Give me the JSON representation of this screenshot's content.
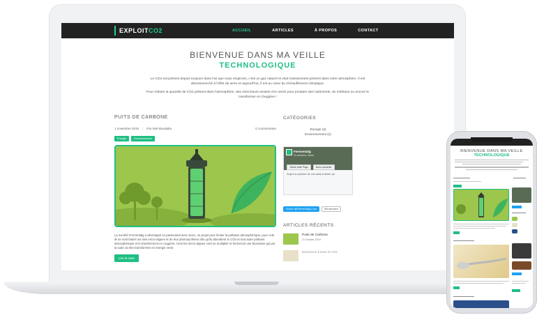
{
  "laptop": {
    "logo": {
      "main": "EXPLOIT",
      "accent": "CO2"
    },
    "nav": [
      {
        "label": "ACCUEIL",
        "active": true
      },
      {
        "label": "ARTICLES",
        "active": false
      },
      {
        "label": "À PROPOS",
        "active": false
      },
      {
        "label": "CONTACT",
        "active": false
      }
    ],
    "hero": {
      "title": "BIENVENUE DANS MA VEILLE",
      "subtitle": "TECHNOLOGIQUE"
    },
    "intro": [
      "Le CO2 est présent depuis toujours dans l'air que nous respirons, c'est un gaz naturel et vital massivement présent dans notre atmosphère. Il est directement lié à l'effet de serre et aujourd'hui, il est au cœur du réchauffement climatique.",
      "Pour réduire la quantité de CO2 présent dans l'atmosphère, des chercheurs veulent s'en servir pour produire des nutriments, du méthane ou encore le transformer en Oxygène !"
    ],
    "post": {
      "title": "PUITS DE CARBONE",
      "date": "1 novembre 2019",
      "author": "Par Noé Boudaba",
      "comments": "0 commentaire",
      "tags": [
        "Énergie",
        "Environnement"
      ],
      "excerpt": "La société Fermentalg a développé en partenariat avec Suez, un projet pour limiter la pollution atmosphérique, pour cela ils se sont basés sur des micro-algues et de leur photosynthèse afin qu'ils absorbent le CO2 et tout autre polluant atmosphérique et le transforment en oxygène. Ainsi les micro-algues vont se multiplier et formeront une biomasse qui par la suite va être transformée en énergie verte.",
      "read_more": "Lire la suite"
    },
    "sidebar": {
      "categories_title": "CATÉGORIES",
      "categories": [
        "Énergie (3)",
        "Environnement (2)"
      ],
      "facebook": {
        "page_name": "Fermentalg",
        "page_sub": "11 mentions J'aime",
        "like_button": "J'aime cette Page",
        "share_button": "Nous contacter",
        "caption": "Soyez le premier de vos amis à aimer ça."
      },
      "twitter": {
        "follow": "Suivre @Fermentalg.Com",
        "secondary": "Mit abonnen"
      },
      "recent_title": "ARTICLES RÉCENTS",
      "recent": [
        {
          "title": "Puits de Carbone",
          "date": "21 October 2019"
        },
        {
          "title": "Bioréacteur à base de CO2",
          "date": ""
        }
      ]
    }
  },
  "phone": {
    "hero": {
      "title": "BIENVENUE DANS MA VEILLE",
      "subtitle": "TECHNOLOGIQUE"
    }
  },
  "colors": {
    "accent": "#1fbf83",
    "nav_bg": "#222222",
    "image_green": "#9cc64c"
  }
}
